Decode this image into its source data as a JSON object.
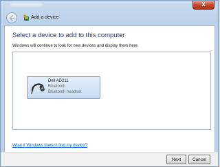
{
  "window": {
    "close_glyph": "x"
  },
  "nav": {
    "back_icon": "back-arrow-icon",
    "wizard_icon": "add-device-icon",
    "title": "Add a device"
  },
  "main": {
    "heading": "Select a device to add to this computer",
    "subtext": "Windows will continue to look for new devices and display them here.",
    "devices": [
      {
        "icon": "bluetooth-headset-icon",
        "name": "Dell AD211",
        "type": "Bluetooth",
        "category": "Bluetooth headset"
      }
    ],
    "help_link": "What if Windows doesn't find my device?"
  },
  "footer": {
    "next_label": "Next",
    "cancel_label": "Cancel"
  },
  "colors": {
    "heading": "#1e3287",
    "link": "#0066cc",
    "selection": "#c6dcf3",
    "close_button": "#c7432a"
  }
}
